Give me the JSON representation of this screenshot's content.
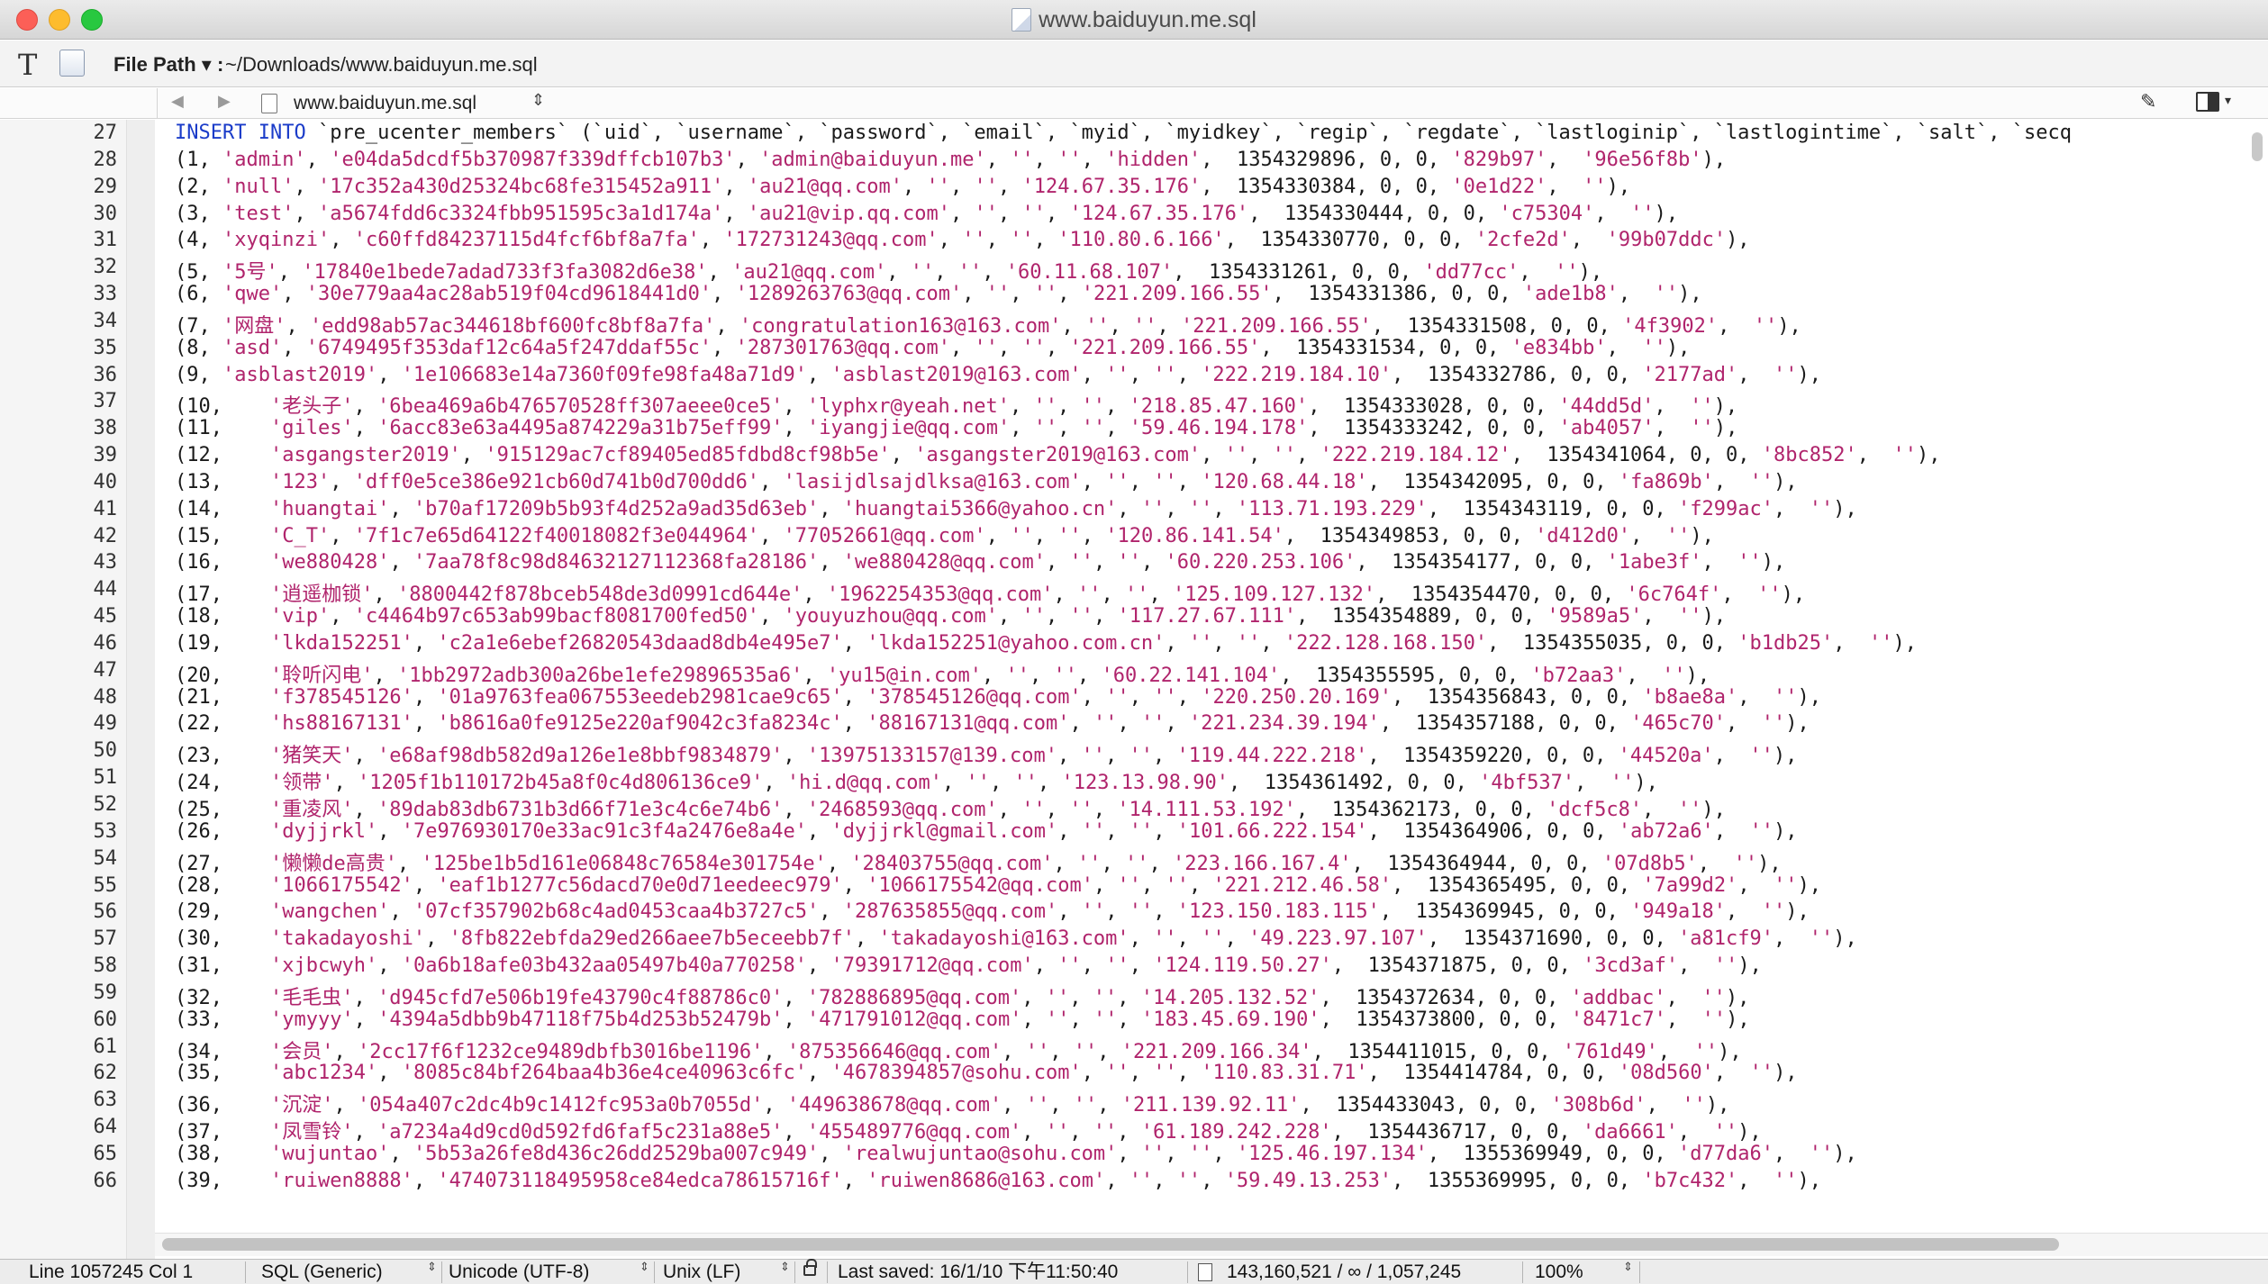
{
  "window": {
    "title": "www.baiduyun.me.sql"
  },
  "pathbar": {
    "label": "File Path ▾ :",
    "value": "~/Downloads/www.baiduyun.me.sql"
  },
  "navbar": {
    "file_name": "www.baiduyun.me.sql"
  },
  "editor": {
    "header_line": {
      "number": "27",
      "keyword": "INSERT INTO",
      "rest": " `pre_ucenter_members` (`uid`, `username`, `password`, `email`, `myid`, `myidkey`, `regip`, `regdate`, `lastloginip`, `lastlogintime`, `salt`, `secq"
    },
    "rows": [
      {
        "n": "28",
        "uid": "1",
        "user": "admin",
        "pw": "e04da5dcdf5b370987f339dffcb107b3",
        "email": "admin@baiduyun.me",
        "myid": "",
        "myidkey": "",
        "regip": "hidden",
        "regdate": "1354329896",
        "zero1": "0",
        "zero2": "0",
        "salt": "829b97",
        "secq": "96e56f8b"
      },
      {
        "n": "29",
        "uid": "2",
        "user": "null",
        "pw": "17c352a430d25324bc68fe315452a911",
        "email": "au21@qq.com",
        "myid": "",
        "myidkey": "",
        "regip": "124.67.35.176",
        "regdate": "1354330384",
        "zero1": "0",
        "zero2": "0",
        "salt": "0e1d22",
        "secq": ""
      },
      {
        "n": "30",
        "uid": "3",
        "user": "test",
        "pw": "a5674fdd6c3324fbb951595c3a1d174a",
        "email": "au21@vip.qq.com",
        "myid": "",
        "myidkey": "",
        "regip": "124.67.35.176",
        "regdate": "1354330444",
        "zero1": "0",
        "zero2": "0",
        "salt": "c75304",
        "secq": ""
      },
      {
        "n": "31",
        "uid": "4",
        "user": "xyqinzi",
        "pw": "c60ffd84237115d4fcf6bf8a7fa",
        "email": "172731243@qq.com",
        "myid": "",
        "myidkey": "",
        "regip": "110.80.6.166",
        "regdate": "1354330770",
        "zero1": "0",
        "zero2": "0",
        "salt": "2cfe2d",
        "secq": "99b07ddc"
      },
      {
        "n": "32",
        "uid": "5",
        "user": "5号",
        "pw": "17840e1bede7adad733f3fa3082d6e38",
        "email": "au21@qq.com",
        "myid": "",
        "myidkey": "",
        "regip": "60.11.68.107",
        "regdate": "1354331261",
        "zero1": "0",
        "zero2": "0",
        "salt": "dd77cc",
        "secq": ""
      },
      {
        "n": "33",
        "uid": "6",
        "user": "qwe",
        "pw": "30e779aa4ac28ab519f04cd9618441d0",
        "email": "1289263763@qq.com",
        "myid": "",
        "myidkey": "",
        "regip": "221.209.166.55",
        "regdate": "1354331386",
        "zero1": "0",
        "zero2": "0",
        "salt": "ade1b8",
        "secq": ""
      },
      {
        "n": "34",
        "uid": "7",
        "user": "网盘",
        "pw": "edd98ab57ac344618bf600fc8bf8a7fa",
        "email": "congratulation163@163.com",
        "myid": "",
        "myidkey": "",
        "regip": "221.209.166.55",
        "regdate": "1354331508",
        "zero1": "0",
        "zero2": "0",
        "salt": "4f3902",
        "secq": ""
      },
      {
        "n": "35",
        "uid": "8",
        "user": "asd",
        "pw": "6749495f353daf12c64a5f247ddaf55c",
        "email": "287301763@qq.com",
        "myid": "",
        "myidkey": "",
        "regip": "221.209.166.55",
        "regdate": "1354331534",
        "zero1": "0",
        "zero2": "0",
        "salt": "e834bb",
        "secq": ""
      },
      {
        "n": "36",
        "uid": "9",
        "user": "asblast2019",
        "pw": "1e106683e14a7360f09fe98fa48a71d9",
        "email": "asblast2019@163.com",
        "myid": "",
        "myidkey": "",
        "regip": "222.219.184.10",
        "regdate": "1354332786",
        "zero1": "0",
        "zero2": "0",
        "salt": "2177ad",
        "secq": ""
      },
      {
        "n": "37",
        "uid": "10",
        "user": "老头子",
        "pw": "6bea469a6b476570528ff307aeee0ce5",
        "email": "lyphxr@yeah.net",
        "myid": "",
        "myidkey": "",
        "regip": "218.85.47.160",
        "regdate": "1354333028",
        "zero1": "0",
        "zero2": "0",
        "salt": "44dd5d",
        "secq": ""
      },
      {
        "n": "38",
        "uid": "11",
        "user": "giles",
        "pw": "6acc83e63a4495a874229a31b75eff99",
        "email": "iyangjie@qq.com",
        "myid": "",
        "myidkey": "",
        "regip": "59.46.194.178",
        "regdate": "1354333242",
        "zero1": "0",
        "zero2": "0",
        "salt": "ab4057",
        "secq": ""
      },
      {
        "n": "39",
        "uid": "12",
        "user": "asgangster2019",
        "pw": "915129ac7cf89405ed85fdbd8cf98b5e",
        "email": "asgangster2019@163.com",
        "myid": "",
        "myidkey": "",
        "regip": "222.219.184.12",
        "regdate": "1354341064",
        "zero1": "0",
        "zero2": "0",
        "salt": "8bc852",
        "secq": ""
      },
      {
        "n": "40",
        "uid": "13",
        "user": "123",
        "pw": "dff0e5ce386e921cb60d741b0d700dd6",
        "email": "lasijdlsajdlksa@163.com",
        "myid": "",
        "myidkey": "",
        "regip": "120.68.44.18",
        "regdate": "1354342095",
        "zero1": "0",
        "zero2": "0",
        "salt": "fa869b",
        "secq": ""
      },
      {
        "n": "41",
        "uid": "14",
        "user": "huangtai",
        "pw": "b70af17209b5b93f4d252a9ad35d63eb",
        "email": "huangtai5366@yahoo.cn",
        "myid": "",
        "myidkey": "",
        "regip": "113.71.193.229",
        "regdate": "1354343119",
        "zero1": "0",
        "zero2": "0",
        "salt": "f299ac",
        "secq": ""
      },
      {
        "n": "42",
        "uid": "15",
        "user": "C_T",
        "pw": "7f1c7e65d64122f40018082f3e044964",
        "email": "77052661@qq.com",
        "myid": "",
        "myidkey": "",
        "regip": "120.86.141.54",
        "regdate": "1354349853",
        "zero1": "0",
        "zero2": "0",
        "salt": "d412d0",
        "secq": ""
      },
      {
        "n": "43",
        "uid": "16",
        "user": "we880428",
        "pw": "7aa78f8c98d84632127112368fa28186",
        "email": "we880428@qq.com",
        "myid": "",
        "myidkey": "",
        "regip": "60.220.253.106",
        "regdate": "1354354177",
        "zero1": "0",
        "zero2": "0",
        "salt": "1abe3f",
        "secq": ""
      },
      {
        "n": "44",
        "uid": "17",
        "user": "逍遥枷锁",
        "pw": "8800442f878bceb548de3d0991cd644e",
        "email": "1962254353@qq.com",
        "myid": "",
        "myidkey": "",
        "regip": "125.109.127.132",
        "regdate": "1354354470",
        "zero1": "0",
        "zero2": "0",
        "salt": "6c764f",
        "secq": ""
      },
      {
        "n": "45",
        "uid": "18",
        "user": "vip",
        "pw": "c4464b97c653ab99bacf8081700fed50",
        "email": "youyuzhou@qq.com",
        "myid": "",
        "myidkey": "",
        "regip": "117.27.67.111",
        "regdate": "1354354889",
        "zero1": "0",
        "zero2": "0",
        "salt": "9589a5",
        "secq": ""
      },
      {
        "n": "46",
        "uid": "19",
        "user": "lkda152251",
        "pw": "c2a1e6ebef26820543daad8db4e495e7",
        "email": "lkda152251@yahoo.com.cn",
        "myid": "",
        "myidkey": "",
        "regip": "222.128.168.150",
        "regdate": "1354355035",
        "zero1": "0",
        "zero2": "0",
        "salt": "b1db25",
        "secq": ""
      },
      {
        "n": "47",
        "uid": "20",
        "user": "聆听闪电",
        "pw": "1bb2972adb300a26be1efe29896535a6",
        "email": "yu15@in.com",
        "myid": "",
        "myidkey": "",
        "regip": "60.22.141.104",
        "regdate": "1354355595",
        "zero1": "0",
        "zero2": "0",
        "salt": "b72aa3",
        "secq": ""
      },
      {
        "n": "48",
        "uid": "21",
        "user": "f378545126",
        "pw": "01a9763fea067553eedeb2981cae9c65",
        "email": "378545126@qq.com",
        "myid": "",
        "myidkey": "",
        "regip": "220.250.20.169",
        "regdate": "1354356843",
        "zero1": "0",
        "zero2": "0",
        "salt": "b8ae8a",
        "secq": ""
      },
      {
        "n": "49",
        "uid": "22",
        "user": "hs88167131",
        "pw": "b8616a0fe9125e220af9042c3fa8234c",
        "email": "88167131@qq.com",
        "myid": "",
        "myidkey": "",
        "regip": "221.234.39.194",
        "regdate": "1354357188",
        "zero1": "0",
        "zero2": "0",
        "salt": "465c70",
        "secq": ""
      },
      {
        "n": "50",
        "uid": "23",
        "user": "猪笑天",
        "pw": "e68af98db582d9a126e1e8bbf9834879",
        "email": "13975133157@139.com",
        "myid": "",
        "myidkey": "",
        "regip": "119.44.222.218",
        "regdate": "1354359220",
        "zero1": "0",
        "zero2": "0",
        "salt": "44520a",
        "secq": ""
      },
      {
        "n": "51",
        "uid": "24",
        "user": "领带",
        "pw": "1205f1b110172b45a8f0c4d806136ce9",
        "email": "hi.d@qq.com",
        "myid": "",
        "myidkey": "",
        "regip": "123.13.98.90",
        "regdate": "1354361492",
        "zero1": "0",
        "zero2": "0",
        "salt": "4bf537",
        "secq": ""
      },
      {
        "n": "52",
        "uid": "25",
        "user": "重凌风",
        "pw": "89dab83db6731b3d66f71e3c4c6e74b6",
        "email": "2468593@qq.com",
        "myid": "",
        "myidkey": "",
        "regip": "14.111.53.192",
        "regdate": "1354362173",
        "zero1": "0",
        "zero2": "0",
        "salt": "dcf5c8",
        "secq": ""
      },
      {
        "n": "53",
        "uid": "26",
        "user": "dyjjrkl",
        "pw": "7e976930170e33ac91c3f4a2476e8a4e",
        "email": "dyjjrkl@gmail.com",
        "myid": "",
        "myidkey": "",
        "regip": "101.66.222.154",
        "regdate": "1354364906",
        "zero1": "0",
        "zero2": "0",
        "salt": "ab72a6",
        "secq": ""
      },
      {
        "n": "54",
        "uid": "27",
        "user": "懒懒de高贵",
        "pw": "125be1b5d161e06848c76584e301754e",
        "email": "28403755@qq.com",
        "myid": "",
        "myidkey": "",
        "regip": "223.166.167.4",
        "regdate": "1354364944",
        "zero1": "0",
        "zero2": "0",
        "salt": "07d8b5",
        "secq": ""
      },
      {
        "n": "55",
        "uid": "28",
        "user": "1066175542",
        "pw": "eaf1b1277c56dacd70e0d71eedeec979",
        "email": "1066175542@qq.com",
        "myid": "",
        "myidkey": "",
        "regip": "221.212.46.58",
        "regdate": "1354365495",
        "zero1": "0",
        "zero2": "0",
        "salt": "7a99d2",
        "secq": ""
      },
      {
        "n": "56",
        "uid": "29",
        "user": "wangchen",
        "pw": "07cf357902b68c4ad0453caa4b3727c5",
        "email": "287635855@qq.com",
        "myid": "",
        "myidkey": "",
        "regip": "123.150.183.115",
        "regdate": "1354369945",
        "zero1": "0",
        "zero2": "0",
        "salt": "949a18",
        "secq": ""
      },
      {
        "n": "57",
        "uid": "30",
        "user": "takadayoshi",
        "pw": "8fb822ebfda29ed266aee7b5eceebb7f",
        "email": "takadayoshi@163.com",
        "myid": "",
        "myidkey": "",
        "regip": "49.223.97.107",
        "regdate": "1354371690",
        "zero1": "0",
        "zero2": "0",
        "salt": "a81cf9",
        "secq": ""
      },
      {
        "n": "58",
        "uid": "31",
        "user": "xjbcwyh",
        "pw": "0a6b18afe03b432aa05497b40a770258",
        "email": "79391712@qq.com",
        "myid": "",
        "myidkey": "",
        "regip": "124.119.50.27",
        "regdate": "1354371875",
        "zero1": "0",
        "zero2": "0",
        "salt": "3cd3af",
        "secq": ""
      },
      {
        "n": "59",
        "uid": "32",
        "user": "毛毛虫",
        "pw": "d945cfd7e506b19fe43790c4f88786c0",
        "email": "782886895@qq.com",
        "myid": "",
        "myidkey": "",
        "regip": "14.205.132.52",
        "regdate": "1354372634",
        "zero1": "0",
        "zero2": "0",
        "salt": "addbac",
        "secq": ""
      },
      {
        "n": "60",
        "uid": "33",
        "user": "ymyyy",
        "pw": "4394a5dbb9b47118f75b4d253b52479b",
        "email": "471791012@qq.com",
        "myid": "",
        "myidkey": "",
        "regip": "183.45.69.190",
        "regdate": "1354373800",
        "zero1": "0",
        "zero2": "0",
        "salt": "8471c7",
        "secq": ""
      },
      {
        "n": "61",
        "uid": "34",
        "user": "会员",
        "pw": "2cc17f6f1232ce9489dbfb3016be1196",
        "email": "875356646@qq.com",
        "myid": "",
        "myidkey": "",
        "regip": "221.209.166.34",
        "regdate": "1354411015",
        "zero1": "0",
        "zero2": "0",
        "salt": "761d49",
        "secq": ""
      },
      {
        "n": "62",
        "uid": "35",
        "user": "abc1234",
        "pw": "8085c84bf264baa4b36e4ce40963c6fc",
        "email": "4678394857@sohu.com",
        "myid": "",
        "myidkey": "",
        "regip": "110.83.31.71",
        "regdate": "1354414784",
        "zero1": "0",
        "zero2": "0",
        "salt": "08d560",
        "secq": ""
      },
      {
        "n": "63",
        "uid": "36",
        "user": "沉淀",
        "pw": "054a407c2dc4b9c1412fc953a0b7055d",
        "email": "449638678@qq.com",
        "myid": "",
        "myidkey": "",
        "regip": "211.139.92.11",
        "regdate": "1354433043",
        "zero1": "0",
        "zero2": "0",
        "salt": "308b6d",
        "secq": ""
      },
      {
        "n": "64",
        "uid": "37",
        "user": "凤雪铃",
        "pw": "a7234a4d9cd0d592fd6faf5c231a88e5",
        "email": "455489776@qq.com",
        "myid": "",
        "myidkey": "",
        "regip": "61.189.242.228",
        "regdate": "1354436717",
        "zero1": "0",
        "zero2": "0",
        "salt": "da6661",
        "secq": ""
      },
      {
        "n": "65",
        "uid": "38",
        "user": "wujuntao",
        "pw": "5b53a26fe8d436c26dd2529ba007c949",
        "email": "realwujuntao@sohu.com",
        "myid": "",
        "myidkey": "",
        "regip": "125.46.197.134",
        "regdate": "1355369949",
        "zero1": "0",
        "zero2": "0",
        "salt": "d77da6",
        "secq": ""
      },
      {
        "n": "66",
        "uid": "39",
        "user": "ruiwen8888",
        "pw": "474073118495958ce84edca78615716f",
        "email": "ruiwen8686@163.com",
        "myid": "",
        "myidkey": "",
        "regip": "59.49.13.253",
        "regdate": "1355369995",
        "zero1": "0",
        "zero2": "0",
        "salt": "b7c432",
        "secq": ""
      }
    ]
  },
  "statusbar": {
    "position": "Line 1057245 Col 1",
    "syntax": "SQL (Generic)",
    "encoding": "Unicode (UTF-8)",
    "line_endings": "Unix (LF)",
    "last_saved": "Last saved: 16/1/10 下午11:50:40",
    "counts": "143,160,521 / ∞ / 1,057,245",
    "zoom": "100%"
  },
  "colors": {
    "keyword": "#1b3cc9",
    "string": "#b0246c"
  },
  "icons": [
    "text-tool-icon",
    "script-icon",
    "back-arrow-icon",
    "forward-arrow-icon",
    "file-icon",
    "pen-icon",
    "split-view-icon",
    "lock-icon",
    "document-icon"
  ]
}
